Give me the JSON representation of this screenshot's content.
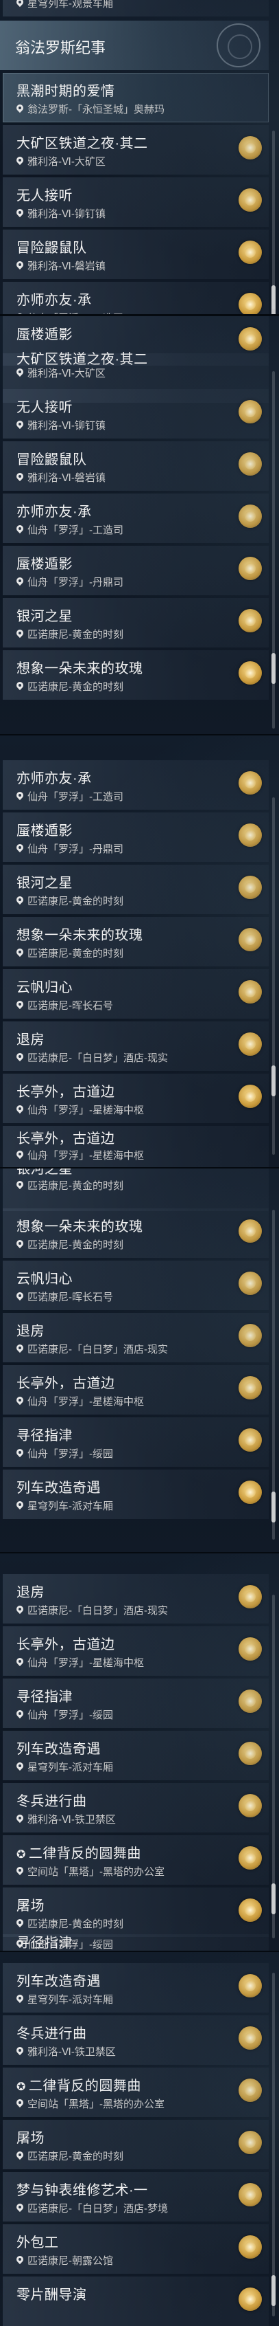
{
  "top_partial": {
    "loc": "星穹列车-观景车厢"
  },
  "chapter_header": {
    "title": "翁法罗斯纪事"
  },
  "quests": {
    "q01": {
      "title": "黑潮时期的爱情",
      "loc": "翁法罗斯-「永恒圣城」奥赫玛"
    },
    "q02": {
      "title": "大矿区铁道之夜·其二",
      "loc": "雅利洛-Ⅵ-大矿区"
    },
    "q03": {
      "title": "无人接听",
      "loc": "雅利洛-Ⅵ-铆钉镇"
    },
    "q04": {
      "title": "冒险鼹鼠队",
      "loc": "雅利洛-Ⅵ-磐岩镇"
    },
    "q05": {
      "title": "亦师亦友·承",
      "loc": "仙舟「罗浮」-工造司"
    },
    "q06": {
      "title": "蜃楼遁影",
      "loc": "仙舟「罗浮」-丹鼎司"
    },
    "q07": {
      "title": "银河之星",
      "loc": "匹诺康尼-黄金的时刻"
    },
    "q08": {
      "title": "想象一朵未来的玫瑰",
      "loc": "匹诺康尼-黄金的时刻"
    },
    "q09": {
      "title": "云帆归心",
      "loc": "匹诺康尼-晖长石号"
    },
    "q10": {
      "title": "退房",
      "loc": "匹诺康尼-「白日梦」酒店-现实"
    },
    "q11": {
      "title": "长亭外，古道边",
      "loc": "仙舟「罗浮」-星槎海中枢"
    },
    "q12": {
      "title": "寻径指津",
      "loc": "仙舟「罗浮」-绥园"
    },
    "q13": {
      "title": "列车改造奇遇",
      "loc": "星穹列车-派对车厢"
    },
    "q14": {
      "title": "冬兵进行曲",
      "loc": "雅利洛-Ⅵ-铁卫禁区"
    },
    "q15": {
      "title": "二律背反的圆舞曲",
      "loc": "空间站「黑塔」-黑塔的办公室"
    },
    "q16": {
      "title": "屠场",
      "loc": "匹诺康尼-黄金的时刻"
    },
    "q17": {
      "title": "梦与钟表维修艺术·一",
      "loc": "匹诺康尼-「白日梦」酒店-梦境"
    },
    "q18": {
      "title": "外包工",
      "loc": "匹诺康尼-朝露公馆"
    },
    "q19": {
      "title": "零片酬导演",
      "loc": ""
    }
  },
  "partials": {
    "p1": "大矿区铁道之夜·其二",
    "p2": "长亭外，古道边",
    "p3": "银河之星",
    "p4": "长亭外，古道边"
  },
  "icons": {
    "location": "location-pin-icon",
    "reward": "reward-coin-icon",
    "battle": "battle-star-icon",
    "emblem": "chapter-emblem-icon"
  },
  "colors": {
    "background": "#0e1826",
    "selected": "#8fa8b8",
    "reward": "#e7c16a"
  }
}
